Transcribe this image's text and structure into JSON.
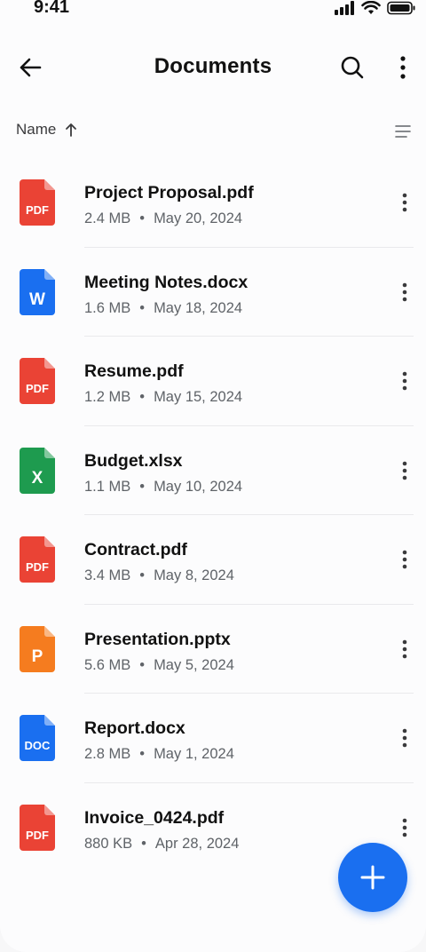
{
  "status_bar": {
    "time": "9:41"
  },
  "header": {
    "title": "Documents"
  },
  "sort": {
    "label": "Name"
  },
  "files": [
    {
      "name": "Project Proposal.pdf",
      "size": "2.4 MB",
      "date": "May 20, 2024",
      "icon": "pdf-file-icon",
      "icon_label": "PDF",
      "color": "#ea4335"
    },
    {
      "name": "Meeting Notes.docx",
      "size": "1.6 MB",
      "date": "May 18, 2024",
      "icon": "word-file-icon",
      "icon_label": "W",
      "color": "#1a6ff0"
    },
    {
      "name": "Resume.pdf",
      "size": "1.2 MB",
      "date": "May 15, 2024",
      "icon": "pdf-file-icon",
      "icon_label": "PDF",
      "color": "#ea4335"
    },
    {
      "name": "Budget.xlsx",
      "size": "1.1 MB",
      "date": "May 10, 2024",
      "icon": "excel-file-icon",
      "icon_label": "X",
      "color": "#1e9b4f"
    },
    {
      "name": "Contract.pdf",
      "size": "3.4 MB",
      "date": "May 8, 2024",
      "icon": "pdf-file-icon",
      "icon_label": "PDF",
      "color": "#ea4335"
    },
    {
      "name": "Presentation.pptx",
      "size": "5.6 MB",
      "date": "May 5, 2024",
      "icon": "powerpoint-file-icon",
      "icon_label": "P",
      "color": "#f57c1f"
    },
    {
      "name": "Report.docx",
      "size": "2.8 MB",
      "date": "May 1, 2024",
      "icon": "doc-file-icon",
      "icon_label": "DOC",
      "color": "#1a6ff0"
    },
    {
      "name": "Invoice_0424.pdf",
      "size": "880 KB",
      "date": "Apr 28, 2024",
      "icon": "pdf-file-icon",
      "icon_label": "PDF",
      "color": "#ea4335"
    }
  ],
  "colors": {
    "accent": "#1a6ff0",
    "pdf": "#ea4335",
    "excel": "#1e9b4f",
    "powerpoint": "#f57c1f"
  }
}
